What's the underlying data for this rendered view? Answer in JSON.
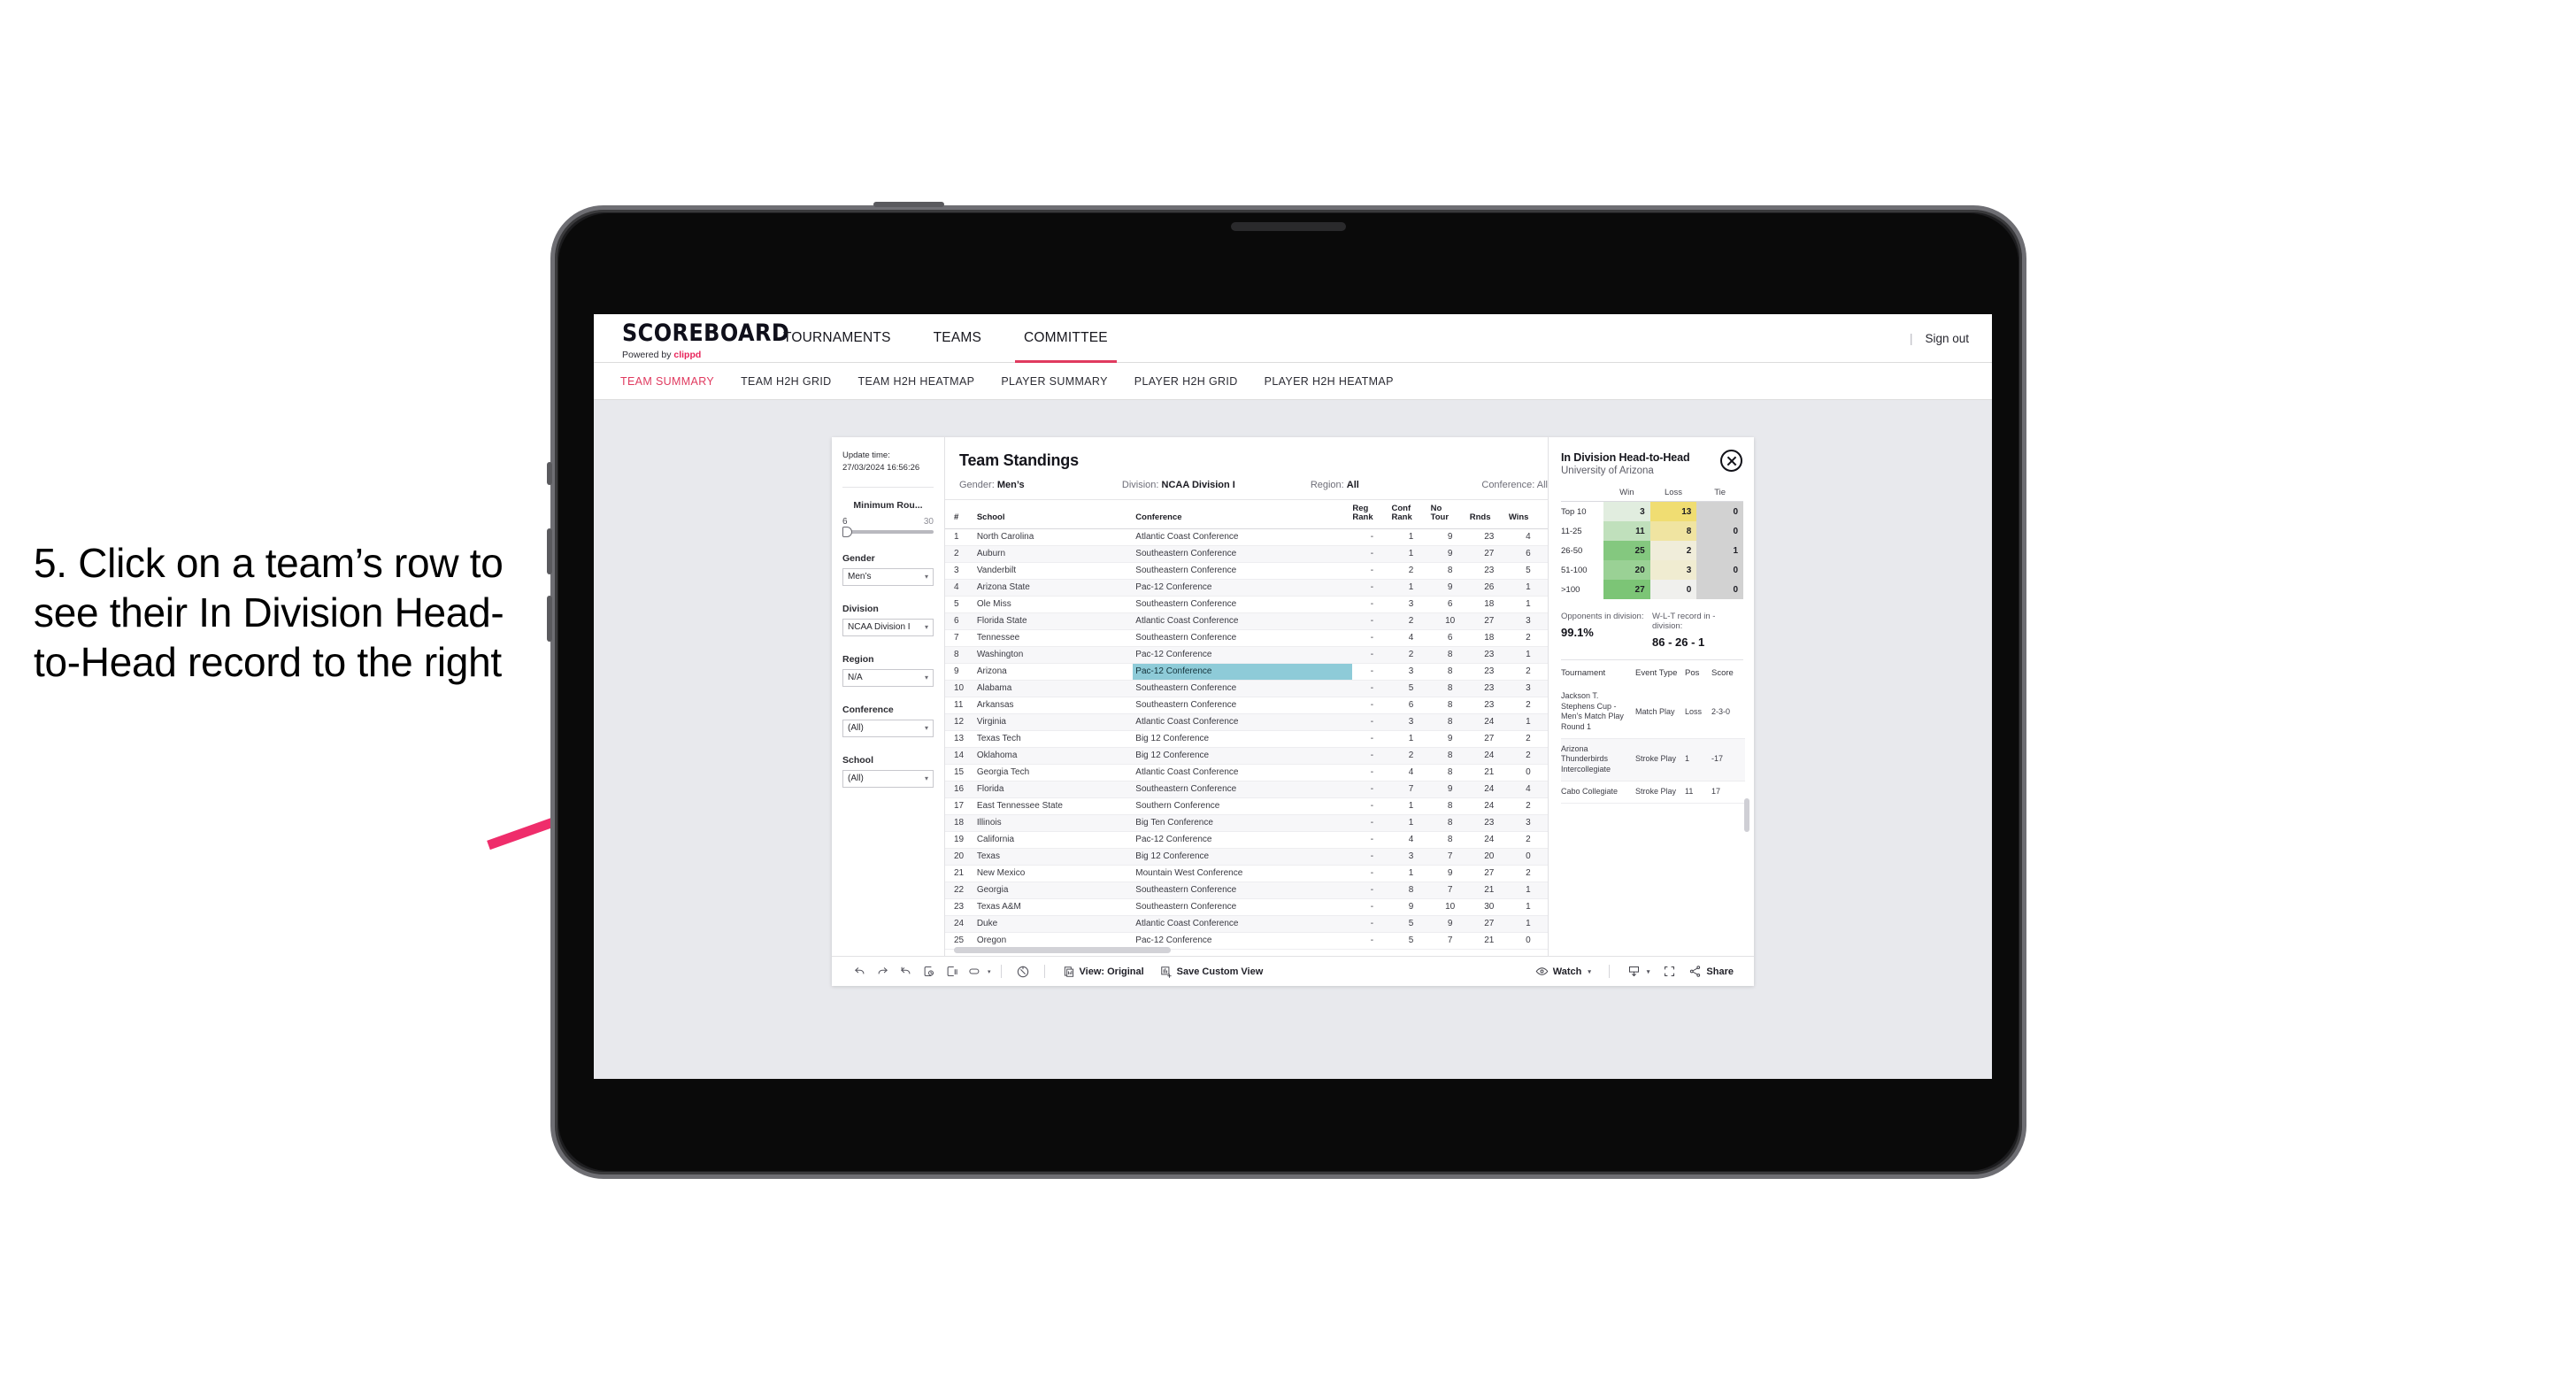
{
  "annotation": {
    "text": "5. Click on a team’s row to see their In Division Head-to-Head record to the right",
    "arrow_color": "#ef2d6b"
  },
  "topnav": {
    "brand_title": "SCOREBOARD",
    "brand_powered": "Powered by",
    "brand_name": "clippd",
    "items": [
      {
        "label": "TOURNAMENTS",
        "active": false
      },
      {
        "label": "TEAMS",
        "active": false
      },
      {
        "label": "COMMITTEE",
        "active": true
      }
    ],
    "divider": "|",
    "signout": "Sign out"
  },
  "subnav": {
    "items": [
      {
        "label": "TEAM SUMMARY",
        "active": true
      },
      {
        "label": "TEAM H2H GRID",
        "active": false
      },
      {
        "label": "TEAM H2H HEATMAP",
        "active": false
      },
      {
        "label": "PLAYER SUMMARY",
        "active": false
      },
      {
        "label": "PLAYER H2H GRID",
        "active": false
      },
      {
        "label": "PLAYER H2H HEATMAP",
        "active": false
      }
    ]
  },
  "filters": {
    "update_time_label": "Update time:",
    "update_time_value": "27/03/2024 16:56:26",
    "slider": {
      "title": "Minimum Rou...",
      "min": "6",
      "max": "30"
    },
    "controls": [
      {
        "label": "Gender",
        "value": "Men’s"
      },
      {
        "label": "Division",
        "value": "NCAA Division I"
      },
      {
        "label": "Region",
        "value": "N/A"
      },
      {
        "label": "Conference",
        "value": "(All)"
      },
      {
        "label": "School",
        "value": "(All)"
      }
    ],
    "caret": "▾"
  },
  "standings": {
    "title": "Team Standings",
    "meta": [
      {
        "label": "Gender:",
        "value": "Men’s"
      },
      {
        "label": "Division:",
        "value": "NCAA Division I"
      },
      {
        "label": "Region:",
        "value": "All"
      },
      {
        "label": "Conference:",
        "value": "All"
      }
    ],
    "columns": [
      "#",
      "School",
      "Conference",
      "Reg Rank",
      "Conf Rank",
      "No Tour",
      "Rnds",
      "Wins"
    ],
    "column_lines": [
      [
        "#",
        ""
      ],
      [
        "School",
        ""
      ],
      [
        "Conference",
        ""
      ],
      [
        "Reg",
        "Rank"
      ],
      [
        "Conf",
        "Rank"
      ],
      [
        "No",
        "Tour"
      ],
      [
        "Rnds",
        ""
      ],
      [
        "Wins",
        ""
      ]
    ],
    "selected_rank": "9",
    "rows": [
      {
        "rank": "1",
        "school": "North Carolina",
        "conference": "Atlantic Coast Conference",
        "reg_rank": "-",
        "conf_rank": "1",
        "no_tour": "9",
        "rnds": "23",
        "wins": "4"
      },
      {
        "rank": "2",
        "school": "Auburn",
        "conference": "Southeastern Conference",
        "reg_rank": "-",
        "conf_rank": "1",
        "no_tour": "9",
        "rnds": "27",
        "wins": "6"
      },
      {
        "rank": "3",
        "school": "Vanderbilt",
        "conference": "Southeastern Conference",
        "reg_rank": "-",
        "conf_rank": "2",
        "no_tour": "8",
        "rnds": "23",
        "wins": "5"
      },
      {
        "rank": "4",
        "school": "Arizona State",
        "conference": "Pac-12 Conference",
        "reg_rank": "-",
        "conf_rank": "1",
        "no_tour": "9",
        "rnds": "26",
        "wins": "1"
      },
      {
        "rank": "5",
        "school": "Ole Miss",
        "conference": "Southeastern Conference",
        "reg_rank": "-",
        "conf_rank": "3",
        "no_tour": "6",
        "rnds": "18",
        "wins": "1"
      },
      {
        "rank": "6",
        "school": "Florida State",
        "conference": "Atlantic Coast Conference",
        "reg_rank": "-",
        "conf_rank": "2",
        "no_tour": "10",
        "rnds": "27",
        "wins": "3"
      },
      {
        "rank": "7",
        "school": "Tennessee",
        "conference": "Southeastern Conference",
        "reg_rank": "-",
        "conf_rank": "4",
        "no_tour": "6",
        "rnds": "18",
        "wins": "2"
      },
      {
        "rank": "8",
        "school": "Washington",
        "conference": "Pac-12 Conference",
        "reg_rank": "-",
        "conf_rank": "2",
        "no_tour": "8",
        "rnds": "23",
        "wins": "1"
      },
      {
        "rank": "9",
        "school": "Arizona",
        "conference": "Pac-12 Conference",
        "reg_rank": "-",
        "conf_rank": "3",
        "no_tour": "8",
        "rnds": "23",
        "wins": "2"
      },
      {
        "rank": "10",
        "school": "Alabama",
        "conference": "Southeastern Conference",
        "reg_rank": "-",
        "conf_rank": "5",
        "no_tour": "8",
        "rnds": "23",
        "wins": "3"
      },
      {
        "rank": "11",
        "school": "Arkansas",
        "conference": "Southeastern Conference",
        "reg_rank": "-",
        "conf_rank": "6",
        "no_tour": "8",
        "rnds": "23",
        "wins": "2"
      },
      {
        "rank": "12",
        "school": "Virginia",
        "conference": "Atlantic Coast Conference",
        "reg_rank": "-",
        "conf_rank": "3",
        "no_tour": "8",
        "rnds": "24",
        "wins": "1"
      },
      {
        "rank": "13",
        "school": "Texas Tech",
        "conference": "Big 12 Conference",
        "reg_rank": "-",
        "conf_rank": "1",
        "no_tour": "9",
        "rnds": "27",
        "wins": "2"
      },
      {
        "rank": "14",
        "school": "Oklahoma",
        "conference": "Big 12 Conference",
        "reg_rank": "-",
        "conf_rank": "2",
        "no_tour": "8",
        "rnds": "24",
        "wins": "2"
      },
      {
        "rank": "15",
        "school": "Georgia Tech",
        "conference": "Atlantic Coast Conference",
        "reg_rank": "-",
        "conf_rank": "4",
        "no_tour": "8",
        "rnds": "21",
        "wins": "0"
      },
      {
        "rank": "16",
        "school": "Florida",
        "conference": "Southeastern Conference",
        "reg_rank": "-",
        "conf_rank": "7",
        "no_tour": "9",
        "rnds": "24",
        "wins": "4"
      },
      {
        "rank": "17",
        "school": "East Tennessee State",
        "conference": "Southern Conference",
        "reg_rank": "-",
        "conf_rank": "1",
        "no_tour": "8",
        "rnds": "24",
        "wins": "2"
      },
      {
        "rank": "18",
        "school": "Illinois",
        "conference": "Big Ten Conference",
        "reg_rank": "-",
        "conf_rank": "1",
        "no_tour": "8",
        "rnds": "23",
        "wins": "3"
      },
      {
        "rank": "19",
        "school": "California",
        "conference": "Pac-12 Conference",
        "reg_rank": "-",
        "conf_rank": "4",
        "no_tour": "8",
        "rnds": "24",
        "wins": "2"
      },
      {
        "rank": "20",
        "school": "Texas",
        "conference": "Big 12 Conference",
        "reg_rank": "-",
        "conf_rank": "3",
        "no_tour": "7",
        "rnds": "20",
        "wins": "0"
      },
      {
        "rank": "21",
        "school": "New Mexico",
        "conference": "Mountain West Conference",
        "reg_rank": "-",
        "conf_rank": "1",
        "no_tour": "9",
        "rnds": "27",
        "wins": "2"
      },
      {
        "rank": "22",
        "school": "Georgia",
        "conference": "Southeastern Conference",
        "reg_rank": "-",
        "conf_rank": "8",
        "no_tour": "7",
        "rnds": "21",
        "wins": "1"
      },
      {
        "rank": "23",
        "school": "Texas A&M",
        "conference": "Southeastern Conference",
        "reg_rank": "-",
        "conf_rank": "9",
        "no_tour": "10",
        "rnds": "30",
        "wins": "1"
      },
      {
        "rank": "24",
        "school": "Duke",
        "conference": "Atlantic Coast Conference",
        "reg_rank": "-",
        "conf_rank": "5",
        "no_tour": "9",
        "rnds": "27",
        "wins": "1"
      },
      {
        "rank": "25",
        "school": "Oregon",
        "conference": "Pac-12 Conference",
        "reg_rank": "-",
        "conf_rank": "5",
        "no_tour": "7",
        "rnds": "21",
        "wins": "0"
      }
    ]
  },
  "h2h": {
    "title": "In Division Head-to-Head",
    "subtitle": "University of Arizona",
    "close_icon": "close-circle-icon",
    "columns": [
      "",
      "Win",
      "Loss",
      "Tie"
    ],
    "rows": [
      {
        "bucket": "Top 10",
        "win": "3",
        "loss": "13",
        "tie": "0"
      },
      {
        "bucket": "11-25",
        "win": "11",
        "loss": "8",
        "tie": "0"
      },
      {
        "bucket": "26-50",
        "win": "25",
        "loss": "2",
        "tie": "1"
      },
      {
        "bucket": "51-100",
        "win": "20",
        "loss": "3",
        "tie": "0"
      },
      {
        "bucket": ">100",
        "win": "27",
        "loss": "0",
        "tie": "0"
      }
    ],
    "stats": [
      {
        "label": "Opponents in division:",
        "value": "99.1%"
      },
      {
        "label": "W-L-T record in -division:",
        "value": "86 - 26 - 1"
      }
    ],
    "tournament_columns": [
      "Tournament",
      "Event Type",
      "Pos",
      "Score"
    ],
    "tournaments": [
      {
        "name": "Jackson T. Stephens Cup - Men’s Match Play Round 1",
        "type": "Match Play",
        "pos": "Loss",
        "score": "2-3-0"
      },
      {
        "name": "Arizona Thunderbirds Intercollegiate",
        "type": "Stroke Play",
        "pos": "1",
        "score": "-17"
      },
      {
        "name": "Cabo Collegiate",
        "type": "Stroke Play",
        "pos": "11",
        "score": "17"
      }
    ]
  },
  "toolbar": {
    "icons": [
      "undo-icon",
      "redo-icon",
      "revert-icon",
      "refresh-data-icon",
      "pause-updates-icon",
      "highlight-icon"
    ],
    "view_label": "View: Original",
    "save_label": "Save Custom View",
    "watch_label": "Watch",
    "share_label": "Share",
    "divider": "|",
    "caret": "▾"
  },
  "chart_data": {
    "type": "heatmap",
    "title": "In Division Head-to-Head",
    "subtitle": "University of Arizona",
    "xlabel": "",
    "ylabel": "",
    "categories_x": [
      "Win",
      "Loss",
      "Tie"
    ],
    "categories_y": [
      "Top 10",
      "11-25",
      "26-50",
      "51-100",
      ">100"
    ],
    "values": [
      [
        3,
        13,
        0
      ],
      [
        11,
        8,
        0
      ],
      [
        25,
        2,
        1
      ],
      [
        20,
        3,
        0
      ],
      [
        27,
        0,
        0
      ]
    ],
    "legend": "none",
    "grid": false,
    "notes": "Win column shaded green (darker = higher), Loss column shaded yellow (darker = higher), Tie column flat grey."
  }
}
